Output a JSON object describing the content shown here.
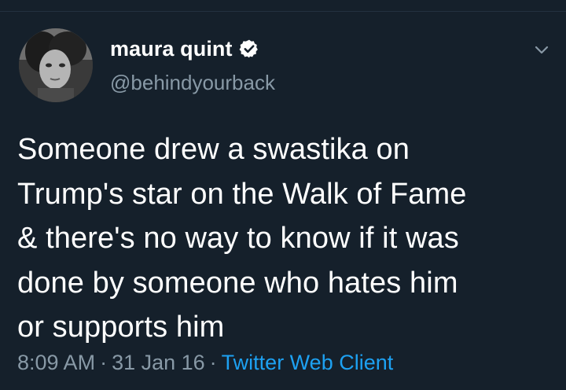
{
  "tweet": {
    "author": {
      "display_name": "maura quint",
      "handle": "@behindyourback",
      "verified": true
    },
    "text": "Someone drew a swastika on\nTrump's star on the Walk of Fame\n& there's no way to know if it was\ndone by someone who hates him\nor supports him",
    "meta": {
      "time": "8:09 AM",
      "separator": "·",
      "date": "31 Jan 16",
      "source": "Twitter Web Client"
    }
  },
  "colors": {
    "background": "#15202b",
    "primary_text": "#ffffff",
    "secondary_text": "#8899a6",
    "link": "#1da1f2"
  },
  "icons": {
    "verified": "verified-badge-icon",
    "menu": "chevron-down-icon"
  }
}
